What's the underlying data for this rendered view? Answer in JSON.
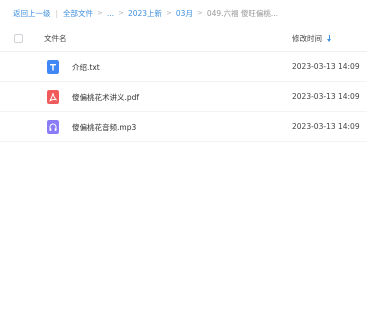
{
  "breadcrumb": {
    "back": "返回上一级",
    "all_files": "全部文件",
    "ellipsis": "...",
    "folder1": "2023上新",
    "folder2": "03月",
    "current": "049.六福 傻旺偏桃..."
  },
  "table": {
    "col_name": "文件名",
    "col_time": "修改时间"
  },
  "files": [
    {
      "name": "介绍.txt",
      "time": "2023-03-13 14:09",
      "type": "txt",
      "icon": "text-file-icon",
      "color": "#3f87f5"
    },
    {
      "name": "傻偏桃花术讲义.pdf",
      "time": "2023-03-13 14:09",
      "type": "pdf",
      "icon": "pdf-file-icon",
      "color": "#f15a5a"
    },
    {
      "name": "傻偏桃花音频.mp3",
      "time": "2023-03-13 14:09",
      "type": "mp3",
      "icon": "audio-file-icon",
      "color": "#8a7cf6"
    }
  ],
  "colors": {
    "link": "#3d8fe0",
    "sort_indicator": "#3d8fe0"
  }
}
